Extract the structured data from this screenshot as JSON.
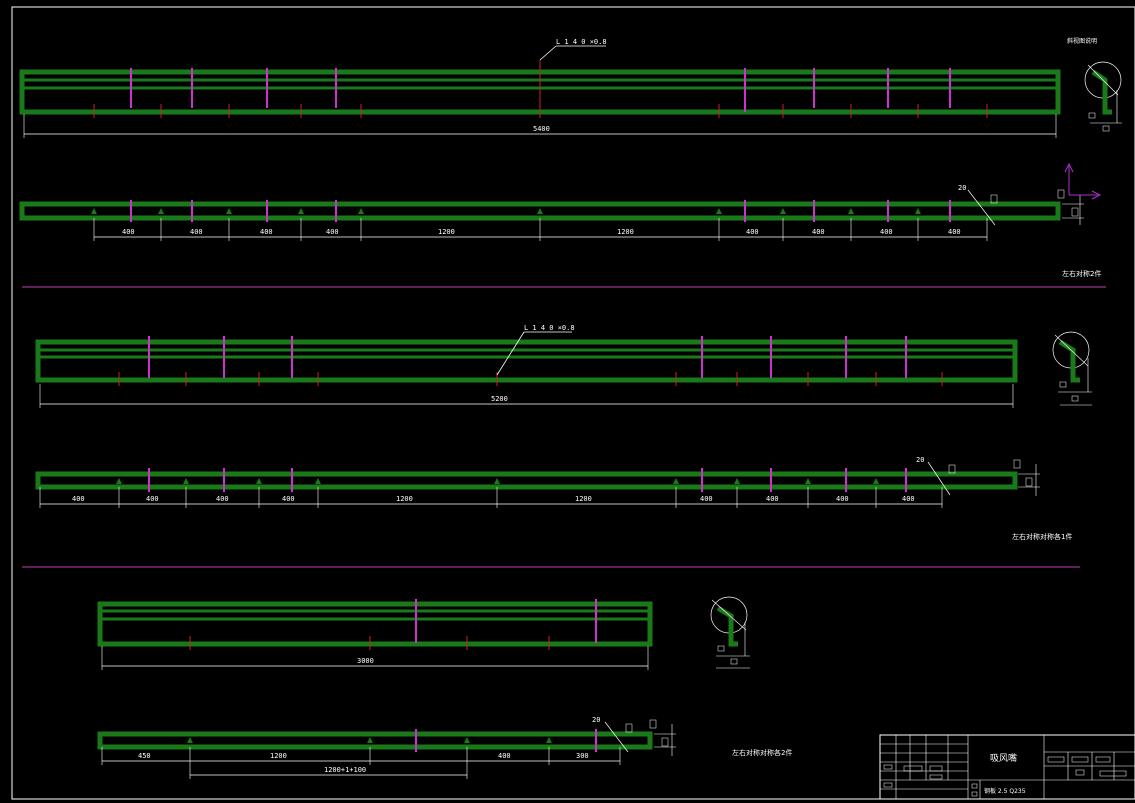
{
  "drawing": {
    "title_block": {
      "title": "吸风嘴",
      "material": "钢板 2.5 Q235"
    },
    "views": [
      {
        "note_main": "L 1 4 0 ×0.8",
        "total_length": "5400",
        "section_label": "斜视图说明",
        "quantity_note": "左右对称2件",
        "segments": [
          "400",
          "400",
          "400",
          "400",
          "1200",
          "1200",
          "400",
          "400",
          "400",
          "400"
        ],
        "end_labels": [
          "20"
        ]
      },
      {
        "note_main": "L 1 4 0 ×0.8",
        "total_length": "5200",
        "quantity_note": "左右对称对称各1件",
        "segments": [
          "400",
          "400",
          "400",
          "400",
          "1200",
          "1200",
          "400",
          "400",
          "400",
          "400"
        ],
        "end_labels": [
          "20"
        ]
      },
      {
        "total_length": "3000",
        "quantity_note": "左右对称对称各2件",
        "segments": [
          "450",
          "1200",
          "1200+1+100",
          "400",
          "300"
        ],
        "end_labels": [
          "20"
        ]
      }
    ],
    "colors": {
      "background": "#000000",
      "border": "#ffffff",
      "profile": "#1a7a1a",
      "stiffener": "#cc33cc",
      "marker": "#cc2222",
      "dimension": "#ffffff",
      "separator": "#c040c0",
      "axis": "#b030d0"
    }
  }
}
